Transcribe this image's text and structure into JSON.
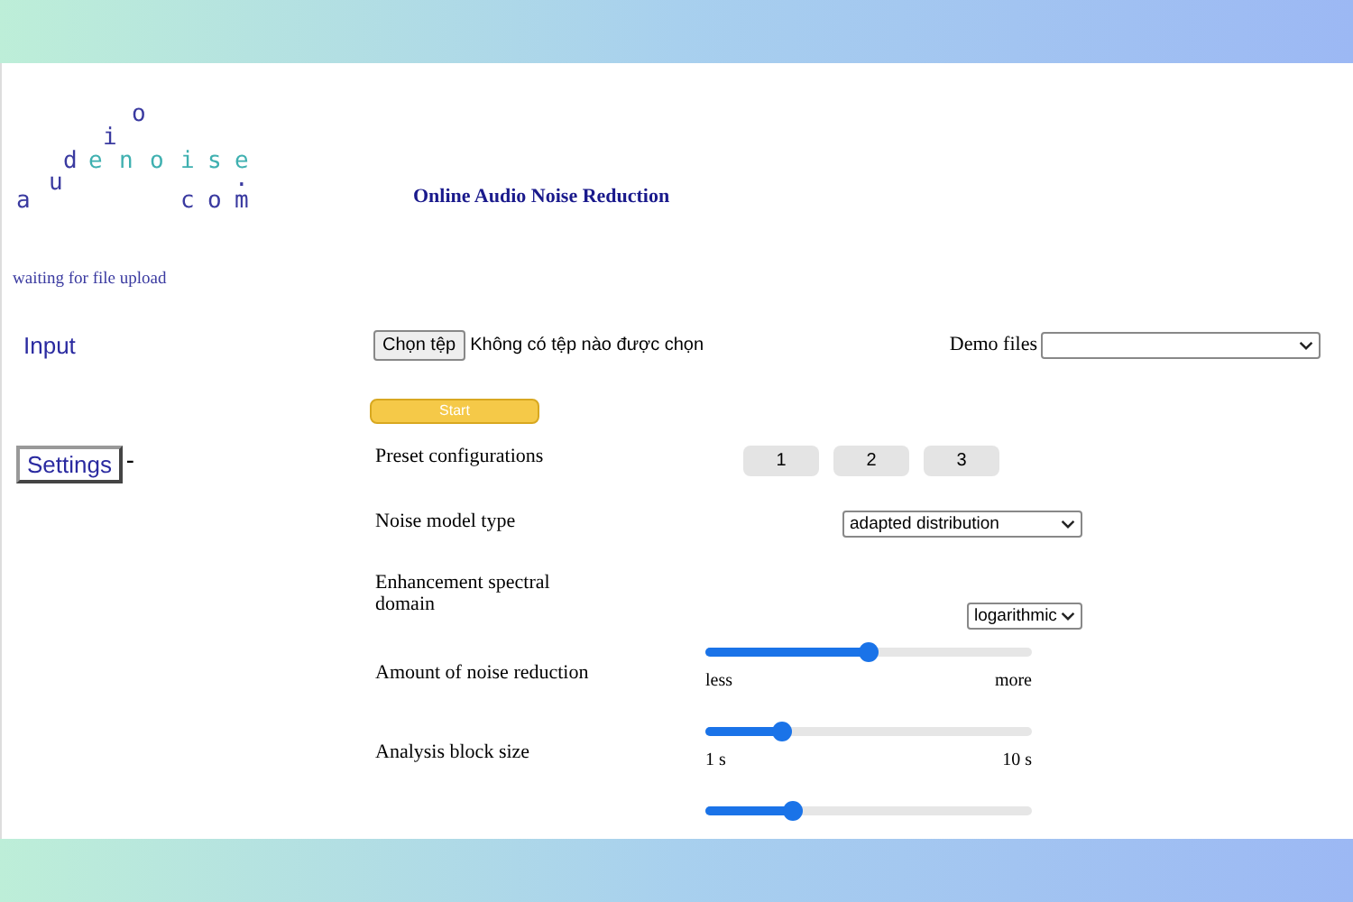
{
  "logo": [
    {
      "text": "a",
      "color": "#3a3aa0"
    },
    {
      "text": "u",
      "color": "#3a3aa0"
    },
    {
      "text": "d",
      "color": "#3a3aa0"
    },
    {
      "text": "i",
      "color": "#3a3aa0"
    },
    {
      "text": "o",
      "color": "#3a3aa0"
    },
    {
      "text": "e",
      "color": "#3fb0b0"
    },
    {
      "text": "n",
      "color": "#3fb0b0"
    },
    {
      "text": "o",
      "color": "#3fb0b0"
    },
    {
      "text": "i",
      "color": "#3fb0b0"
    },
    {
      "text": "s",
      "color": "#3fb0b0"
    },
    {
      "text": "e",
      "color": "#3fb0b0"
    },
    {
      "text": ".",
      "color": "#3a3aa0"
    },
    {
      "text": "c",
      "color": "#3a3aa0"
    },
    {
      "text": "o",
      "color": "#3a3aa0"
    },
    {
      "text": "m",
      "color": "#3a3aa0"
    }
  ],
  "title": "Online Audio Noise Reduction",
  "status": "waiting for file upload",
  "input": {
    "label": "Input",
    "file_button": "Chọn tệp",
    "file_text": "Không có tệp nào được chọn",
    "demo_label": "Demo files"
  },
  "start_button": {
    "label": "Start",
    "disabled": true
  },
  "settings": {
    "label": "Settings",
    "toggle": "-"
  },
  "rows": [
    {
      "kind": "buttons",
      "label": "Preset configurations",
      "buttons": [
        "1",
        "2",
        "3"
      ]
    },
    {
      "kind": "select",
      "label": "Noise model type",
      "value": "adapted distribution"
    },
    {
      "kind": "select",
      "label": "Enhancement spectral domain",
      "value": "logarithmic"
    },
    {
      "kind": "slider",
      "label": "Amount of noise reduction",
      "level": 0.5,
      "min_label": "less",
      "max_label": "more"
    },
    {
      "kind": "slider",
      "label": "Analysis block size",
      "level": 0.24,
      "min_label": "1 s",
      "max_label": "10 s"
    },
    {
      "kind": "slider",
      "level": 0.27
    }
  ]
}
